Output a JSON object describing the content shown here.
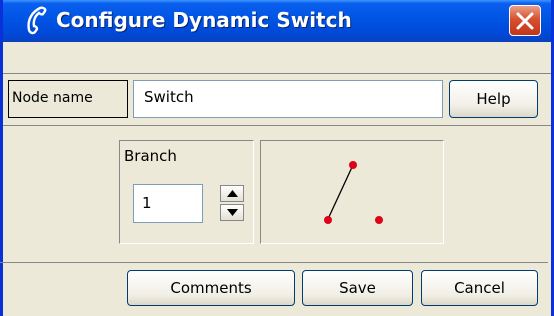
{
  "window": {
    "title": "Configure Dynamic Switch"
  },
  "node": {
    "label": "Node name",
    "value": "Switch"
  },
  "help_label": "Help",
  "branch": {
    "label": "Branch",
    "value": "1"
  },
  "buttons": {
    "comments": "Comments",
    "save": "Save",
    "cancel": "Cancel"
  },
  "colors": {
    "titlebar": "#0054e3",
    "close": "#d8502f",
    "background": "#ece9d8",
    "diagram_dot": "#e0001a"
  },
  "icons": {
    "title": "phone-handset-icon",
    "close": "close-icon",
    "up": "arrow-up-icon",
    "down": "arrow-down-icon"
  }
}
